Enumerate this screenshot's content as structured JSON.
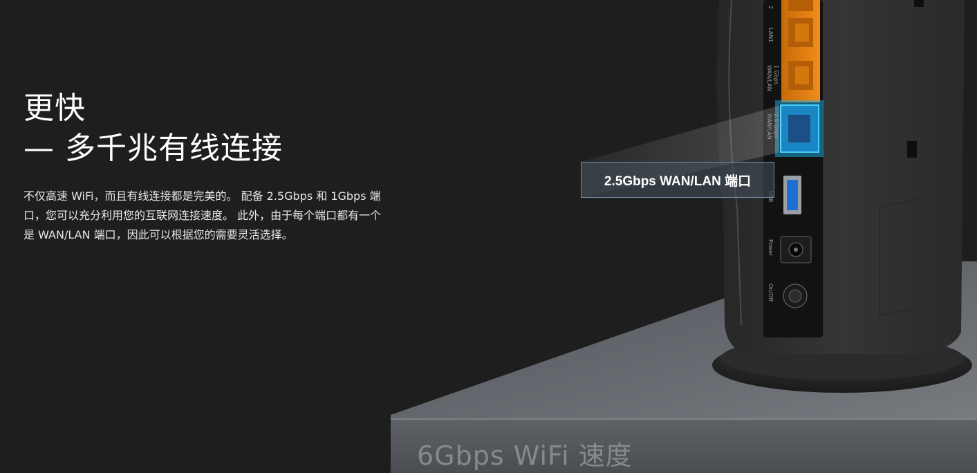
{
  "heading": {
    "line1": "更快",
    "line2": "— 多千兆有线连接"
  },
  "description": "不仅高速 WiFi，而且有线连接都是完美的。 配备 2.5Gbps 和 1Gbps 端口，您可以充分利用您的互联网连接速度。 此外，由于每个端口都有一个是 WAN/LAN 端口，因此可以根据您的需要灵活选择。",
  "callout": {
    "label": "2.5Gbps WAN/LAN 端口"
  },
  "router_ports": {
    "lan2": "2",
    "lan1": "LAN1",
    "gbps_line1": "1 Gbps",
    "gbps_line2": "WAN/LAN",
    "gbps25_line1": "2.5 Gbps",
    "gbps25_line2": "WAN/LAN",
    "usb": "USB",
    "power": "Power",
    "onoff": "On/Off"
  },
  "next_section": {
    "title": "6Gbps WiFi 速度"
  },
  "colors": {
    "background": "#1e1e1e",
    "lan_port_orange": "#e07a10",
    "highlight_blue": "#1ab2ec",
    "pedestal_grey": "#6a6e72",
    "router_body": "#2f2f2f"
  }
}
